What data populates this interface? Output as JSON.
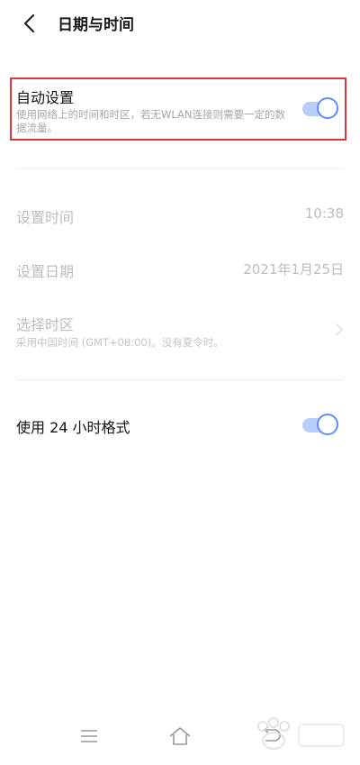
{
  "header": {
    "title": "日期与时间"
  },
  "auto_setting": {
    "title": "自动设置",
    "subtitle": "使用网络上的时间和时区，若无WLAN连接则需要一定的数据流量。",
    "enabled": true
  },
  "set_time": {
    "title": "设置时间",
    "value": "10:38"
  },
  "set_date": {
    "title": "设置日期",
    "value": "2021年1月25日"
  },
  "timezone": {
    "title": "选择时区",
    "subtitle": "采用中国时间 (GMT+08:00)。没有夏令时。"
  },
  "format_24h": {
    "title": "使用 24 小时格式",
    "enabled": true
  },
  "colors": {
    "accent": "#5b8ef7",
    "highlight": "#d9363e"
  }
}
